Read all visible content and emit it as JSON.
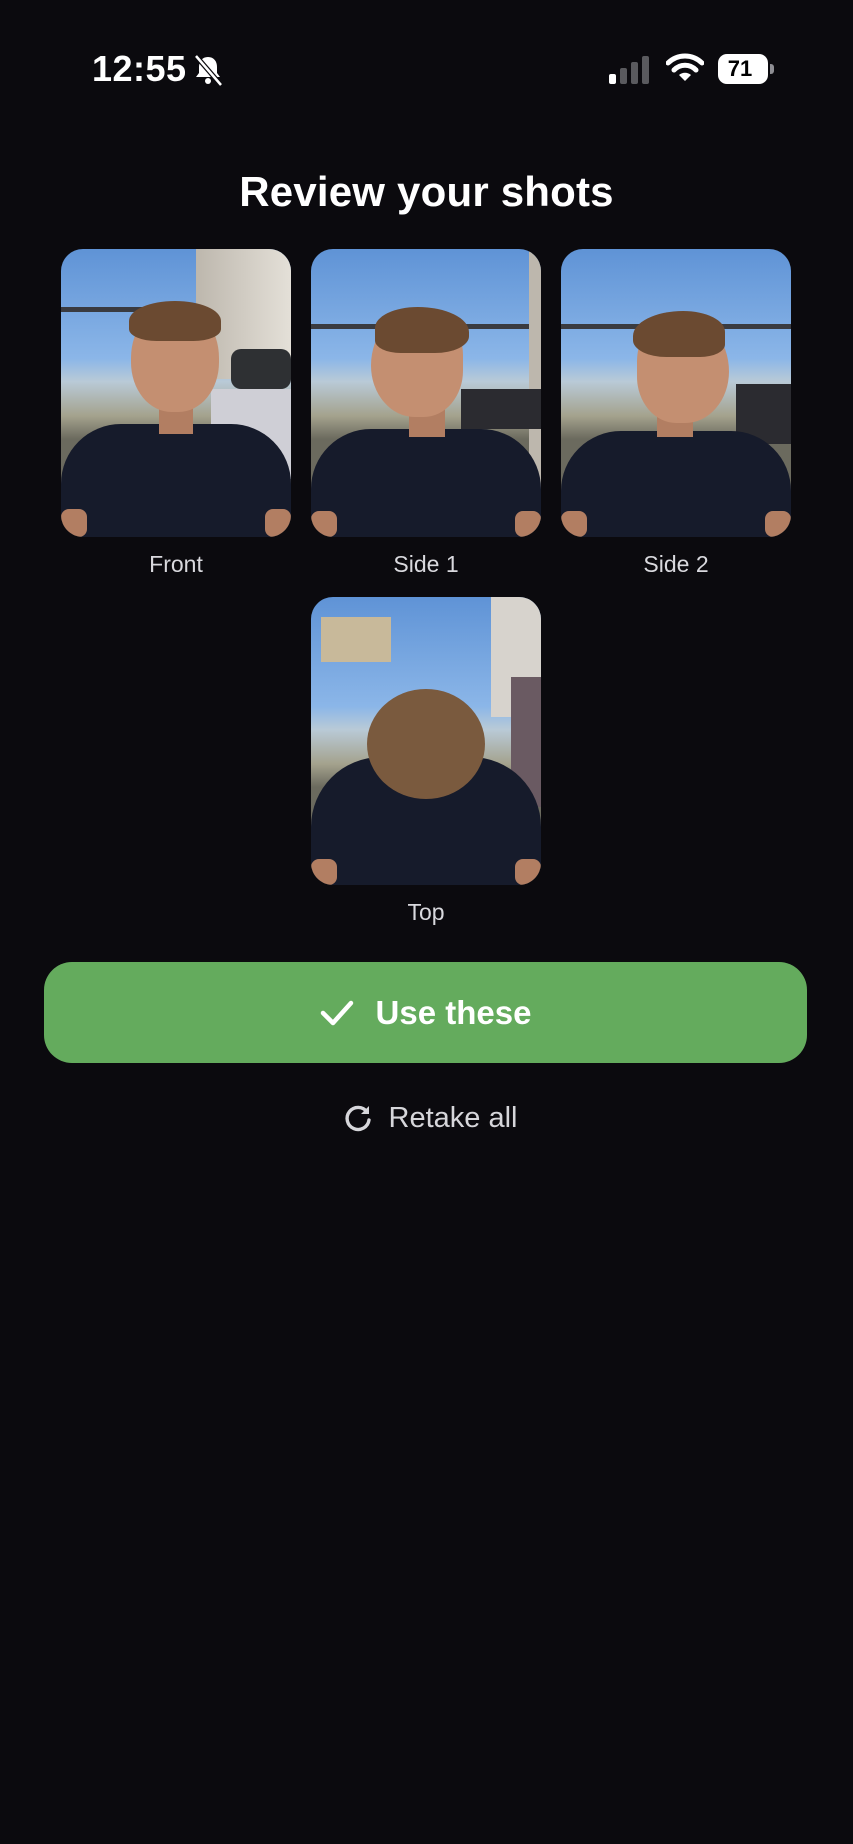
{
  "status_bar": {
    "time": "12:55",
    "battery": "71",
    "icons": [
      "bell-slash-icon",
      "signal-icon",
      "wifi-icon",
      "battery-icon"
    ]
  },
  "title": "Review your shots",
  "shots": [
    {
      "label": "Front"
    },
    {
      "label": "Side 1"
    },
    {
      "label": "Side 2"
    },
    {
      "label": "Top"
    }
  ],
  "primary_action": {
    "label": "Use these",
    "icon": "checkmark-icon",
    "color": "#64ab5d"
  },
  "secondary_action": {
    "label": "Retake all",
    "icon": "refresh-icon"
  },
  "colors": {
    "background": "#0b0a0e",
    "accent": "#64ab5d"
  }
}
